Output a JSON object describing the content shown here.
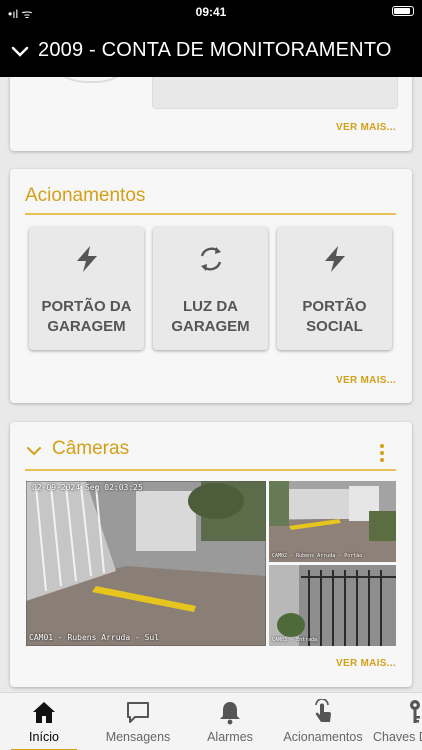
{
  "status_bar": {
    "time": "09:41"
  },
  "header": {
    "title": "2009 - CONTA DE MONITORAMENTO",
    "toggle_icon": "chevron-down-icon"
  },
  "colors": {
    "accent": "#d4a017",
    "header_bg": "#000000",
    "card_bg": "#f7f7f7",
    "page_bg": "#e9e9e9"
  },
  "monitoring": {
    "more_label": "VER MAIS..."
  },
  "acionamentos": {
    "title": "Acionamentos",
    "buttons": [
      {
        "label": "PORTÃO DA GARAGEM",
        "icon": "lightning-icon"
      },
      {
        "label": "LUZ DA GARAGEM",
        "icon": "refresh-icon"
      },
      {
        "label": "PORTÃO SOCIAL",
        "icon": "lightning-icon"
      }
    ],
    "more_label": "VER MAIS..."
  },
  "cameras": {
    "title": "Câmeras",
    "feeds": [
      {
        "timestamp": "02-09-2024 Seg 02:03:25",
        "caption": "CAM01 - Rubens Arruda - Sul"
      },
      {
        "timestamp": "",
        "caption": "CAM02 - Rubens Arruda - Portão"
      },
      {
        "timestamp": "",
        "caption": "CAM03 - Entrada"
      }
    ],
    "more_label": "VER MAIS..."
  },
  "tabs": [
    {
      "label": "Início",
      "icon": "home-icon",
      "active": true
    },
    {
      "label": "Mensagens",
      "icon": "message-icon",
      "active": false
    },
    {
      "label": "Alarmes",
      "icon": "bell-icon",
      "active": false
    },
    {
      "label": "Acionamentos",
      "icon": "touch-hand-icon",
      "active": false
    },
    {
      "label": "Chaves D",
      "icon": "key-icon",
      "active": false
    }
  ]
}
